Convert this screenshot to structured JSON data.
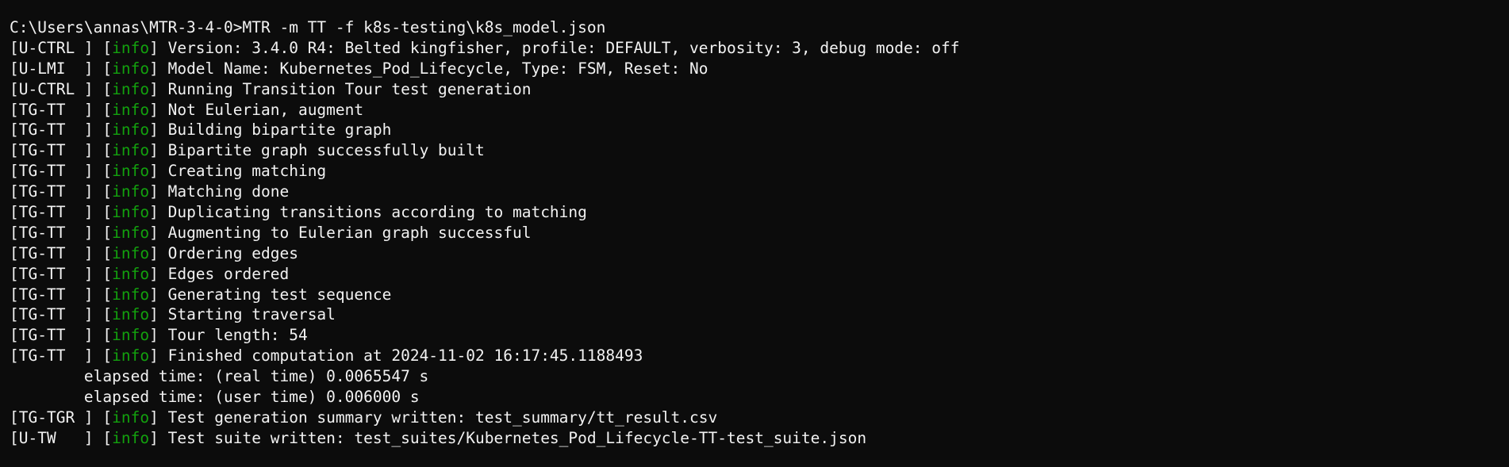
{
  "terminal": {
    "prompt": "C:\\Users\\annas\\MTR-3-4-0>",
    "command": "MTR -m TT -f k8s-testing\\k8s_model.json",
    "colors": {
      "background": "#0c0c0c",
      "foreground": "#f2f2f2",
      "info": "#13a10e"
    },
    "log_lines": [
      {
        "tag": "[U-CTRL ] [",
        "level": "info",
        "message": "] Version: 3.4.0 R4: Belted kingfisher, profile: DEFAULT, verbosity: 3, debug mode: off"
      },
      {
        "tag": "[U-LMI  ] [",
        "level": "info",
        "message": "] Model Name: Kubernetes_Pod_Lifecycle, Type: FSM, Reset: No"
      },
      {
        "tag": "[U-CTRL ] [",
        "level": "info",
        "message": "] Running Transition Tour test generation"
      },
      {
        "tag": "[TG-TT  ] [",
        "level": "info",
        "message": "] Not Eulerian, augment"
      },
      {
        "tag": "[TG-TT  ] [",
        "level": "info",
        "message": "] Building bipartite graph"
      },
      {
        "tag": "[TG-TT  ] [",
        "level": "info",
        "message": "] Bipartite graph successfully built"
      },
      {
        "tag": "[TG-TT  ] [",
        "level": "info",
        "message": "] Creating matching"
      },
      {
        "tag": "[TG-TT  ] [",
        "level": "info",
        "message": "] Matching done"
      },
      {
        "tag": "[TG-TT  ] [",
        "level": "info",
        "message": "] Duplicating transitions according to matching"
      },
      {
        "tag": "[TG-TT  ] [",
        "level": "info",
        "message": "] Augmenting to Eulerian graph successful"
      },
      {
        "tag": "[TG-TT  ] [",
        "level": "info",
        "message": "] Ordering edges"
      },
      {
        "tag": "[TG-TT  ] [",
        "level": "info",
        "message": "] Edges ordered"
      },
      {
        "tag": "[TG-TT  ] [",
        "level": "info",
        "message": "] Generating test sequence"
      },
      {
        "tag": "[TG-TT  ] [",
        "level": "info",
        "message": "] Starting traversal"
      },
      {
        "tag": "[TG-TT  ] [",
        "level": "info",
        "message": "] Tour length: 54"
      },
      {
        "tag": "[TG-TT  ] [",
        "level": "info",
        "message": "] Finished computation at 2024-11-02 16:17:45.1188493"
      }
    ],
    "elapsed": [
      "        elapsed time: (real time) 0.0065547 s",
      "        elapsed time: (user time) 0.006000 s"
    ],
    "final_lines": [
      {
        "tag": "[TG-TGR ] [",
        "level": "info",
        "message": "] Test generation summary written: test_summary/tt_result.csv"
      },
      {
        "tag": "[U-TW   ] [",
        "level": "info",
        "message": "] Test suite written: test_suites/Kubernetes_Pod_Lifecycle-TT-test_suite.json"
      }
    ]
  }
}
